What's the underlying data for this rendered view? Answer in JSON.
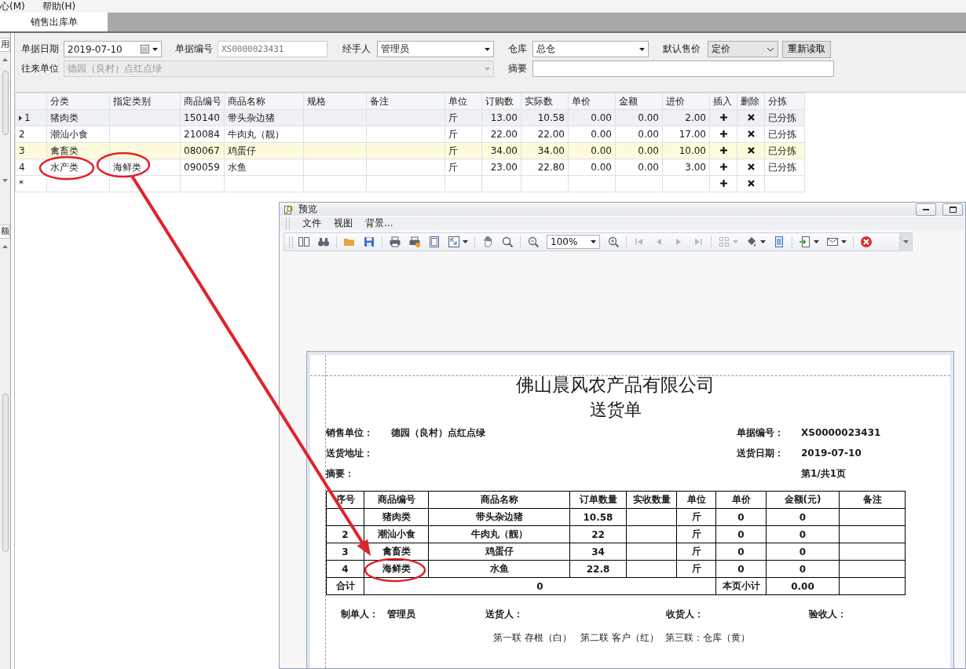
{
  "menu": [
    {
      "label": "心(M)"
    },
    {
      "label": "帮助(H)"
    }
  ],
  "tabs": [
    {
      "label": "销售出库单",
      "selected": true
    }
  ],
  "side_strip": {
    "top_label": "用",
    "bottom_label": "额"
  },
  "form": {
    "fields": [
      {
        "kind": "date",
        "label": "单据日期",
        "value": "2019-07-10",
        "disabled": false
      },
      {
        "kind": "readonly",
        "label": "单据编号",
        "value": "XS0000023431",
        "disabled": false
      },
      {
        "kind": "dropdown",
        "label": "经手人",
        "value": "管理员",
        "disabled": false
      },
      {
        "kind": "dropdown",
        "label": "仓库",
        "value": "总仓",
        "disabled": false
      },
      {
        "kind": "select",
        "label": "默认售价",
        "value": "定价",
        "disabled": false
      },
      {
        "kind": "button",
        "label": "重新读取",
        "disabled": false
      },
      {
        "kind": "dropdown",
        "label": "往来单位",
        "value": "德园（良村）点红点绿",
        "disabled": true
      },
      {
        "kind": "text",
        "label": "摘要",
        "disabled": false
      }
    ]
  },
  "grid": {
    "columns": [
      {
        "label": "分类",
        "kind": "text"
      },
      {
        "label": "指定类别",
        "kind": "text"
      },
      {
        "label": "商品编号",
        "kind": "text"
      },
      {
        "label": "商品名称",
        "kind": "text"
      },
      {
        "label": "规格",
        "kind": "text"
      },
      {
        "label": "备注",
        "kind": "text"
      },
      {
        "label": "单位",
        "kind": "text"
      },
      {
        "label": "订购数",
        "kind": "number"
      },
      {
        "label": "实际数",
        "kind": "number"
      },
      {
        "label": "单价",
        "kind": "number"
      },
      {
        "label": "金额",
        "kind": "number"
      },
      {
        "label": "进价",
        "kind": "number"
      },
      {
        "label": "插入",
        "kind": "insert"
      },
      {
        "label": "删除",
        "kind": "delete"
      },
      {
        "label": "分拣",
        "kind": "text"
      }
    ],
    "rows": [
      {
        "indicator": "1",
        "current": true,
        "highlighted": false,
        "cells": {
          "category": "猪肉类",
          "code": "150140",
          "name": "带头杂边猪",
          "unit": "斤",
          "ordered": "13.00",
          "actual": "10.58",
          "price": "0.00",
          "amount": "0.00",
          "cost": "2.00",
          "sorted": "已分拣"
        }
      },
      {
        "indicator": "2",
        "current": false,
        "highlighted": false,
        "cells": {
          "category": "潮汕小食",
          "code": "210084",
          "name": "牛肉丸（靓）",
          "unit": "斤",
          "ordered": "22.00",
          "actual": "22.00",
          "price": "0.00",
          "amount": "0.00",
          "cost": "17.00",
          "sorted": "已分拣"
        }
      },
      {
        "indicator": "3",
        "current": false,
        "highlighted": true,
        "cells": {
          "category": "禽畜类",
          "code": "080067",
          "name": "鸡蛋仔",
          "unit": "斤",
          "ordered": "34.00",
          "actual": "34.00",
          "price": "0.00",
          "amount": "0.00",
          "cost": "10.00",
          "sorted": "已分拣"
        }
      },
      {
        "indicator": "4",
        "current": false,
        "highlighted": false,
        "cells": {
          "category": "水产类",
          "assigned": "海鲜类",
          "code": "090059",
          "name": "水鱼",
          "unit": "斤",
          "ordered": "23.00",
          "actual": "22.80",
          "price": "0.00",
          "amount": "0.00",
          "cost": "3.00",
          "sorted": "已分拣"
        }
      },
      {
        "indicator": "*",
        "current": false,
        "highlighted": false,
        "cells": {}
      }
    ]
  },
  "preview_window": {
    "title": "预览",
    "menu": [
      "文件",
      "视图",
      "背景..."
    ],
    "toolbar": {
      "groups": [
        [
          {
            "kind": "panel",
            "disabled": false,
            "dropdown": false
          },
          {
            "kind": "find",
            "disabled": false,
            "dropdown": false
          }
        ],
        [
          {
            "kind": "open",
            "disabled": false,
            "dropdown": false
          },
          {
            "kind": "save",
            "disabled": false,
            "dropdown": false
          }
        ],
        [
          {
            "kind": "print",
            "disabled": false,
            "dropdown": false
          },
          {
            "kind": "quickprint",
            "disabled": false,
            "dropdown": false
          },
          {
            "kind": "pagesetup",
            "disabled": false,
            "dropdown": false
          },
          {
            "kind": "scale",
            "disabled": false,
            "dropdown": true
          }
        ],
        [
          {
            "kind": "hand",
            "disabled": false,
            "dropdown": false
          },
          {
            "kind": "magnifier",
            "disabled": false,
            "dropdown": false
          }
        ],
        [
          {
            "kind": "zoomout",
            "disabled": false,
            "dropdown": false
          },
          {
            "kind": "zoom",
            "value": "100%",
            "disabled": false,
            "dropdown": true
          },
          {
            "kind": "zoomin",
            "disabled": false,
            "dropdown": false
          }
        ],
        [
          {
            "kind": "first",
            "disabled": true,
            "dropdown": false
          },
          {
            "kind": "prev",
            "disabled": true,
            "dropdown": false
          },
          {
            "kind": "next",
            "disabled": true,
            "dropdown": false
          },
          {
            "kind": "last",
            "disabled": true,
            "dropdown": false
          }
        ],
        [
          {
            "kind": "multipage",
            "disabled": true,
            "dropdown": true
          },
          {
            "kind": "color",
            "disabled": false,
            "dropdown": true
          },
          {
            "kind": "watermark",
            "disabled": false,
            "dropdown": false
          }
        ],
        [
          {
            "kind": "export",
            "disabled": false,
            "dropdown": true
          },
          {
            "kind": "email",
            "disabled": false,
            "dropdown": true
          }
        ],
        [
          {
            "kind": "close",
            "disabled": false,
            "dropdown": false
          }
        ]
      ]
    },
    "report": {
      "title": "佛山晨风农产品有限公司",
      "subtitle": "送货单",
      "info": [
        {
          "label": "销售单位：",
          "value": "德园（良村）点红点绿"
        },
        {
          "label": "单据编号：",
          "value": "XS0000023431"
        },
        {
          "label": "送货地址："
        },
        {
          "label": "送货日期：",
          "value": "2019-07-10"
        },
        {
          "label": "摘要："
        },
        {
          "value": "第1/共1页"
        }
      ],
      "columns": [
        {
          "label": "序号"
        },
        {
          "label": "商品编号"
        },
        {
          "label": "商品名称"
        },
        {
          "label": "订单数量"
        },
        {
          "label": "实收数量"
        },
        {
          "label": "单位"
        },
        {
          "label": "单价"
        },
        {
          "label": "金额(元)"
        },
        {
          "label": "备注"
        }
      ],
      "rows": [
        {
          "code": "猪肉类",
          "name": "带头杂边猪",
          "qty": "10.58",
          "unit": "斤",
          "price": "0",
          "amount": "0"
        },
        {
          "seq": "2",
          "code": "潮汕小食",
          "name": "牛肉丸（靓）",
          "qty": "22",
          "unit": "斤",
          "price": "0",
          "amount": "0"
        },
        {
          "seq": "3",
          "code": "禽畜类",
          "name": "鸡蛋仔",
          "qty": "34",
          "unit": "斤",
          "price": "0",
          "amount": "0"
        },
        {
          "seq": "4",
          "code": "海鲜类",
          "name": "水鱼",
          "qty": "22.8",
          "unit": "斤",
          "price": "0",
          "amount": "0"
        }
      ],
      "total": {
        "label": "合计",
        "value": "0",
        "subtotal_label": "本页小计",
        "subtotal": "0.00"
      },
      "signatures": [
        {
          "label": "制单人：",
          "value": "管理员"
        },
        {
          "label": "送货人："
        },
        {
          "label": "收货人："
        },
        {
          "label": "验收人："
        }
      ],
      "footer": "第一联 存根（白）   第二联 客户（红）  第三联：仓库（黄）"
    }
  },
  "annotations": [
    {
      "kind": "ellipse"
    },
    {
      "kind": "ellipse"
    },
    {
      "kind": "arrow"
    },
    {
      "kind": "ellipse"
    }
  ]
}
